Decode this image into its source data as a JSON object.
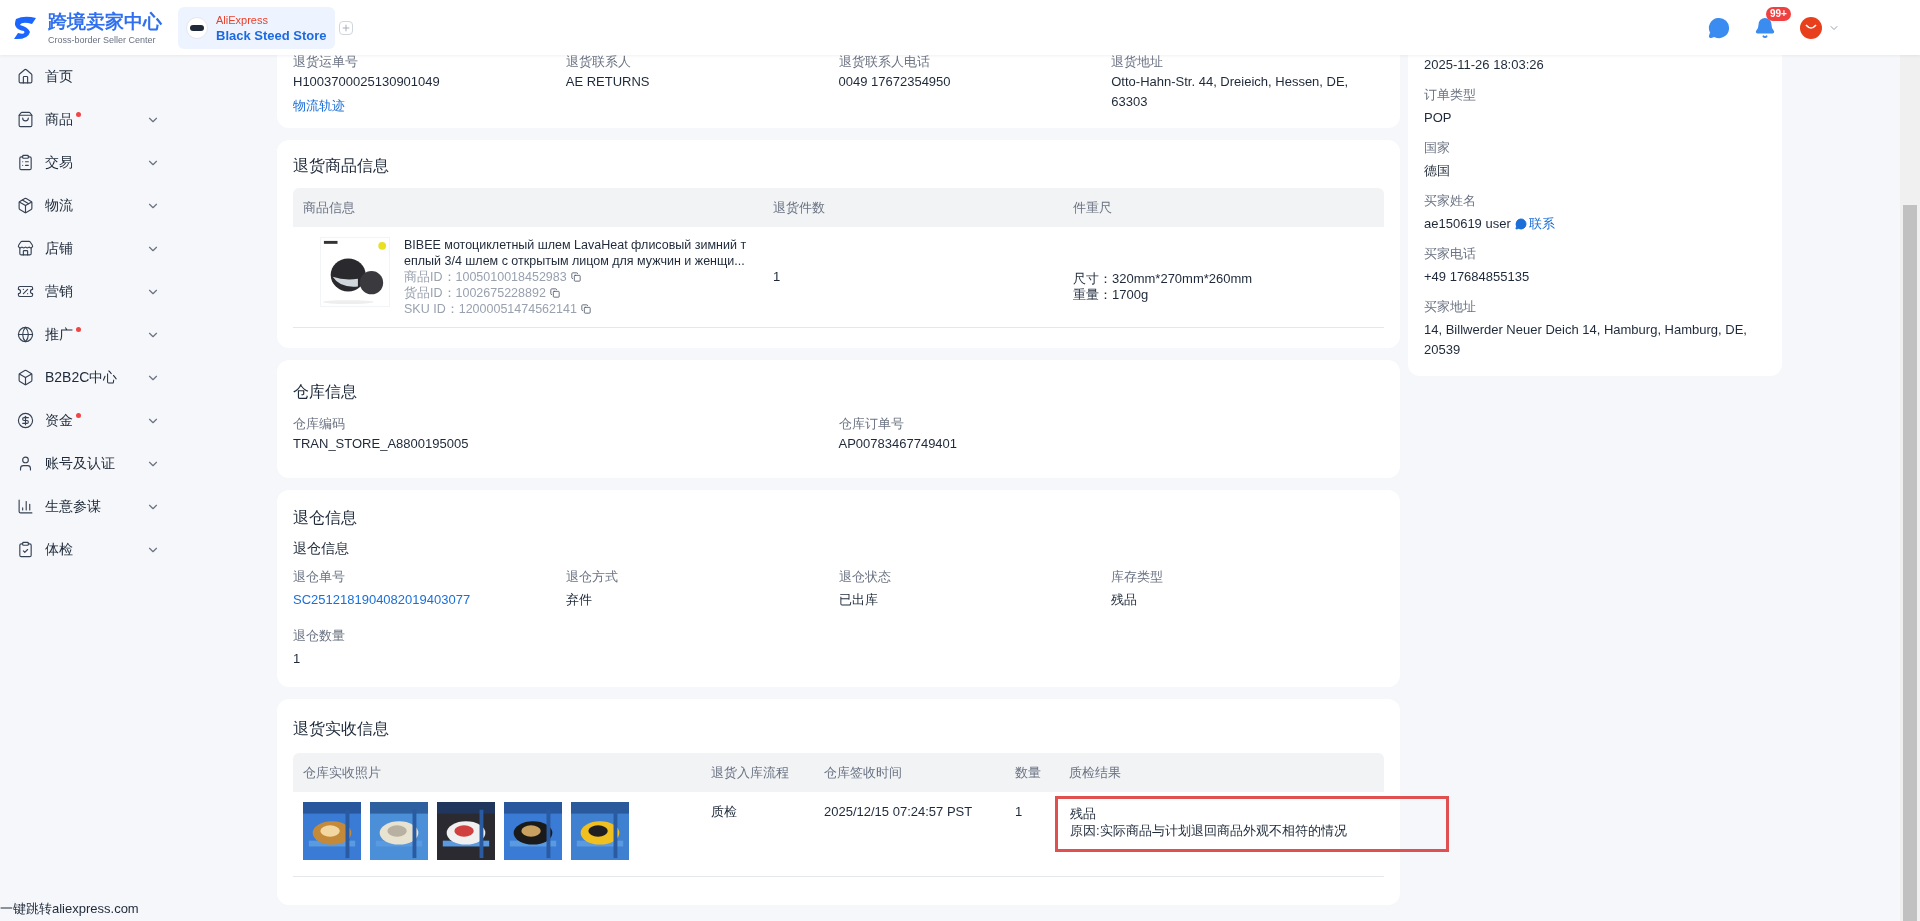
{
  "header": {
    "logo_title": "跨境卖家中心",
    "logo_subtitle": "Cross-border Seller Center",
    "store_platform": "AliExpress",
    "store_name": "Black Steed Store",
    "notification_badge": "99+"
  },
  "sidebar": {
    "items": [
      {
        "label": "首页",
        "kind": "link",
        "dot": false
      },
      {
        "label": "商品",
        "kind": "group",
        "dot": true,
        "expanded": false
      },
      {
        "label": "交易",
        "kind": "group",
        "dot": false,
        "expanded": false
      },
      {
        "label": "物流",
        "kind": "group",
        "dot": false,
        "expanded": false
      },
      {
        "label": "店铺",
        "kind": "group",
        "dot": false,
        "expanded": false
      },
      {
        "label": "营销",
        "kind": "group",
        "dot": false,
        "expanded": false
      },
      {
        "label": "推广",
        "kind": "group",
        "dot": true,
        "expanded": false
      },
      {
        "label": "B2B2C中心",
        "kind": "group",
        "dot": false,
        "expanded": false
      },
      {
        "label": "资金",
        "kind": "group",
        "dot": true,
        "expanded": false
      },
      {
        "label": "账号及认证",
        "kind": "group",
        "dot": false,
        "expanded": false
      },
      {
        "label": "生意参谋",
        "kind": "group",
        "dot": false,
        "expanded": false
      },
      {
        "label": "体检",
        "kind": "group",
        "dot": false,
        "expanded": false
      }
    ]
  },
  "return_shipment": {
    "fields": [
      {
        "label": "退货运单号",
        "value": "H1003700025130901049",
        "link": "物流轨迹"
      },
      {
        "label": "退货联系人",
        "value": "AE RETURNS"
      },
      {
        "label": "退货联系人电话",
        "value": "0049 17672354950"
      },
      {
        "label": "退货地址",
        "value": "Otto-Hahn-Str. 44, Dreieich, Hessen, DE, 63303"
      }
    ]
  },
  "return_goods": {
    "title": "退货商品信息",
    "columns": [
      "商品信息",
      "退货件数",
      "件重尺"
    ],
    "rows": [
      {
        "title_lines": [
          "BIBEE мотоциклетный шлем LavaHeat флисовый зимний т",
          "еплый 3/4 шлем с открытым лицом для мужчин и женщи..."
        ],
        "ids": [
          {
            "label": "商品ID：",
            "value": "1005010018452983"
          },
          {
            "label": "货品ID：",
            "value": "1002675228892"
          },
          {
            "label": "SKU ID：",
            "value": "12000051474562141"
          }
        ],
        "quantity": "1",
        "size": "尺寸：320mm*270mm*260mm",
        "weight": "重量：1700g"
      }
    ]
  },
  "warehouse": {
    "title": "仓库信息",
    "fields": [
      {
        "label": "仓库编码",
        "value": "TRAN_STORE_A8800195005"
      },
      {
        "label": "仓库订单号",
        "value": "AP00783467749401"
      }
    ]
  },
  "warehouse_return": {
    "title": "退仓信息",
    "subtitle": "退仓信息",
    "fields": [
      {
        "label": "退仓单号",
        "value": "SC2512181904082019403077",
        "kind": "link"
      },
      {
        "label": "退仓方式",
        "value": "弃件",
        "kind": "text"
      },
      {
        "label": "退仓状态",
        "value": "已出库",
        "kind": "text"
      },
      {
        "label": "库存类型",
        "value": "残品",
        "kind": "text"
      },
      {
        "label": "退仓数量",
        "value": "1",
        "kind": "text"
      }
    ]
  },
  "received": {
    "title": "退货实收信息",
    "columns": [
      "仓库实收照片",
      "退货入库流程",
      "仓库签收时间",
      "数量",
      "质检结果"
    ],
    "rows": [
      {
        "process": "质检",
        "time": "2025/12/15 07:24:57 PST",
        "quantity": "1",
        "result": "残品",
        "reason": "原因:实际商品与计划退回商品外观不相符的情况",
        "highlighted": true
      }
    ]
  },
  "order_panel": {
    "fields": [
      {
        "value": "2025-11-26 18:03:26"
      },
      {
        "label": "订单类型",
        "value": "POP"
      },
      {
        "label": "国家",
        "value": "德国"
      },
      {
        "label": "买家姓名",
        "value": "ae150619 user",
        "link": "联系"
      },
      {
        "label": "买家电话",
        "value": "+49 17684855135"
      },
      {
        "label": "买家地址",
        "value": "14, Billwerder Neuer Deich 14, Hamburg, Hamburg, DE, 20539"
      }
    ]
  },
  "footer_link": "一键跳转aliexpress.com"
}
